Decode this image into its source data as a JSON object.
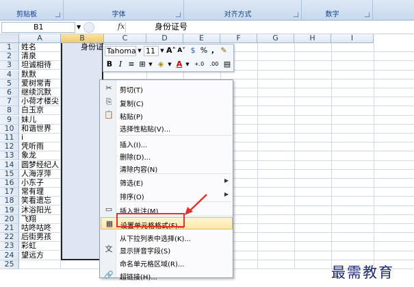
{
  "ribbon": {
    "groups": [
      "剪贴板",
      "字体",
      "对齐方式",
      "数字"
    ]
  },
  "formula_bar": {
    "name_box": "B1",
    "fx": "fx",
    "content": "身份证号"
  },
  "columns": [
    "A",
    "B",
    "C",
    "D",
    "E",
    "F",
    "G",
    "H",
    "I"
  ],
  "rows": [
    {
      "n": "1",
      "a": "姓名"
    },
    {
      "n": "2",
      "a": "清泉"
    },
    {
      "n": "3",
      "a": "坦诚相待"
    },
    {
      "n": "4",
      "a": "默默"
    },
    {
      "n": "5",
      "a": "爱树常青"
    },
    {
      "n": "6",
      "a": "继续沉默"
    },
    {
      "n": "7",
      "a": "小荷才楼尖"
    },
    {
      "n": "8",
      "a": "白玉京"
    },
    {
      "n": "9",
      "a": "妹儿"
    },
    {
      "n": "10",
      "a": "和谐世界"
    },
    {
      "n": "11",
      "a": "i"
    },
    {
      "n": "12",
      "a": "凭听雨"
    },
    {
      "n": "13",
      "a": "象龙"
    },
    {
      "n": "14",
      "a": "圆梦经纪人"
    },
    {
      "n": "15",
      "a": "人海浮萍"
    },
    {
      "n": "16",
      "a": "小东子"
    },
    {
      "n": "17",
      "a": "常有理"
    },
    {
      "n": "18",
      "a": "笑看遗忘"
    },
    {
      "n": "19",
      "a": "沐浴阳光"
    },
    {
      "n": "20",
      "a": "飞翔"
    },
    {
      "n": "21",
      "a": "咕咚咕咚"
    },
    {
      "n": "22",
      "a": "后街男孩"
    },
    {
      "n": "23",
      "a": "彩虹"
    },
    {
      "n": "24",
      "a": "望远方"
    },
    {
      "n": "25",
      "a": ""
    }
  ],
  "b1_text": "身份证",
  "mini_toolbar": {
    "font": "Tahoma",
    "size": "11",
    "grow": "A˄",
    "shrink": "A˅",
    "percent": "%",
    "comma": ",",
    "bold": "B",
    "italic": "I",
    "align": "≡",
    "font_color": "A",
    "inc_decimal": "+.0",
    "dec_decimal": ".00"
  },
  "context_menu": {
    "items": [
      {
        "label": "剪切(T)",
        "icon": "✂"
      },
      {
        "label": "复制(C)",
        "icon": "⎘"
      },
      {
        "label": "粘贴(P)",
        "icon": "📋"
      },
      {
        "label": "选择性粘贴(V)...",
        "icon": ""
      },
      {
        "label": "插入(I)...",
        "icon": ""
      },
      {
        "label": "删除(D)...",
        "icon": ""
      },
      {
        "label": "清除内容(N)",
        "icon": ""
      },
      {
        "label": "筛选(E)",
        "icon": "",
        "submenu": true
      },
      {
        "label": "排序(O)",
        "icon": "",
        "submenu": true
      },
      {
        "label": "插入批注(M)",
        "icon": "▭"
      },
      {
        "label": "设置单元格格式(F)...",
        "icon": "▦"
      },
      {
        "label": "从下拉列表中选择(K)...",
        "icon": ""
      },
      {
        "label": "显示拼音字段(S)",
        "icon": "文"
      },
      {
        "label": "命名单元格区域(R)...",
        "icon": ""
      },
      {
        "label": "超链接(H)...",
        "icon": "🔗"
      }
    ]
  },
  "watermark": "最需教育",
  "colors": {
    "highlight": "#fde8a8",
    "annotation": "#e0322a",
    "selection_fill": "#dfe6f3"
  }
}
